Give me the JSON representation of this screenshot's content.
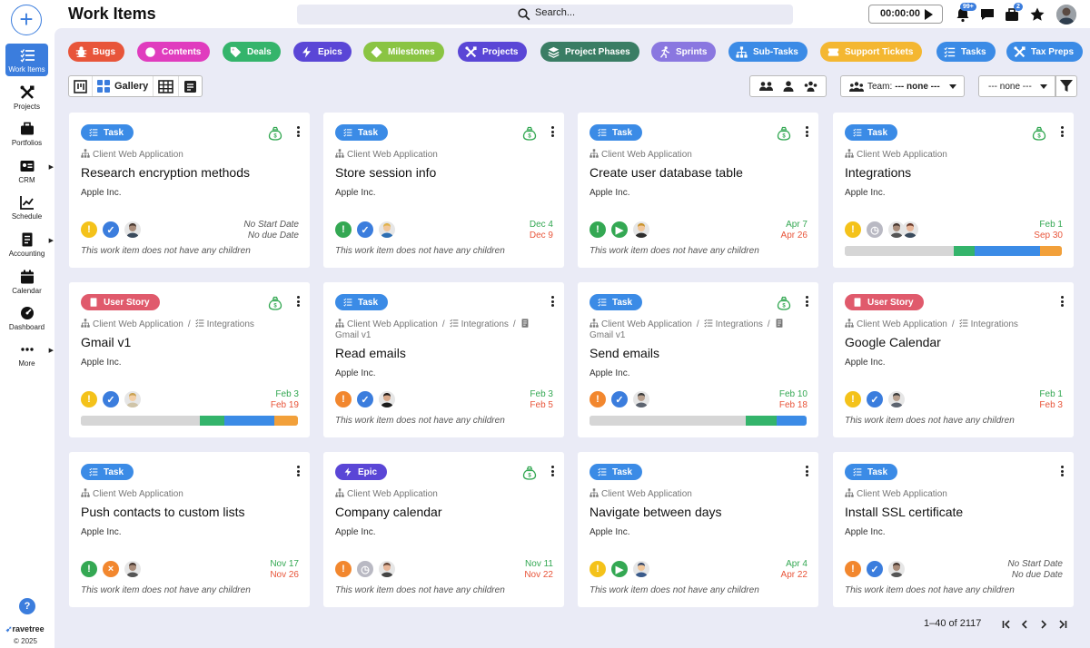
{
  "app": {
    "title": "Work Items"
  },
  "search": {
    "placeholder": "Search..."
  },
  "timer": {
    "value": "00:00:00"
  },
  "notifications": {
    "badge": "99+"
  },
  "cart": {
    "badge": "2"
  },
  "sidebar": {
    "items": [
      {
        "label": "Work Items",
        "icon": "work-items-icon",
        "active": true
      },
      {
        "label": "Projects",
        "icon": "tools-icon"
      },
      {
        "label": "Portfolios",
        "icon": "briefcase-icon"
      },
      {
        "label": "CRM",
        "icon": "contact-card-icon",
        "has_submenu": true
      },
      {
        "label": "Schedule",
        "icon": "chart-icon"
      },
      {
        "label": "Accounting",
        "icon": "ledger-icon",
        "has_submenu": true
      },
      {
        "label": "Calendar",
        "icon": "calendar-icon"
      },
      {
        "label": "Dashboard",
        "icon": "speedometer-icon"
      },
      {
        "label": "More",
        "icon": "ellipsis-icon",
        "has_submenu": true
      }
    ],
    "help_label": "?",
    "brand": "ravetree",
    "copyright": "© 2025"
  },
  "filters": [
    {
      "label": "Bugs",
      "color": "#e8553a",
      "icon": "bug-icon"
    },
    {
      "label": "Contents",
      "color": "#e03cbe",
      "icon": "circle-icon"
    },
    {
      "label": "Deals",
      "color": "#34b46b",
      "icon": "tag-icon"
    },
    {
      "label": "Epics",
      "color": "#5a46d6",
      "icon": "bolt-icon"
    },
    {
      "label": "Milestones",
      "color": "#8ac443",
      "icon": "diamond-icon"
    },
    {
      "label": "Projects",
      "color": "#5a46d6",
      "icon": "tools-icon"
    },
    {
      "label": "Project Phases",
      "color": "#3a7d64",
      "icon": "layers-icon"
    },
    {
      "label": "Sprints",
      "color": "#8a77e0",
      "icon": "runner-icon"
    },
    {
      "label": "Sub-Tasks",
      "color": "#3b8be6",
      "icon": "hierarchy-icon"
    },
    {
      "label": "Support Tickets",
      "color": "#f4b731",
      "icon": "ticket-icon"
    },
    {
      "label": "Tasks",
      "color": "#3b8be6",
      "icon": "checklist-icon"
    },
    {
      "label": "Tax Preps",
      "color": "#3b8be6",
      "icon": "tools-icon"
    }
  ],
  "view": {
    "gallery_label": "Gallery"
  },
  "team_select": {
    "label": "Team:",
    "value": "--- none ---"
  },
  "secondary_select": {
    "value": "--- none ---"
  },
  "cards": [
    {
      "type": "Task",
      "type_color": "#3b8be6",
      "path": [
        "Client Web Application"
      ],
      "title": "Research encryption methods",
      "company": "Apple Inc.",
      "statuses": [
        "yellow-warning",
        "blue-check"
      ],
      "start": "No Start Date",
      "due": "No due Date",
      "dates_none": true,
      "note": "This work item does not have any children",
      "money": true
    },
    {
      "type": "Task",
      "type_color": "#3b8be6",
      "path": [
        "Client Web Application"
      ],
      "title": "Store session info",
      "company": "Apple Inc.",
      "statuses": [
        "green-warning",
        "blue-check"
      ],
      "start": "Dec 4",
      "due": "Dec 9",
      "start_color": "#34a853",
      "due_color": "#e8553a",
      "note": "This work item does not have any children",
      "money": true
    },
    {
      "type": "Task",
      "type_color": "#3b8be6",
      "path": [
        "Client Web Application"
      ],
      "title": "Create user database table",
      "company": "Apple Inc.",
      "statuses": [
        "green-warning",
        "green-play"
      ],
      "start": "Apr 7",
      "due": "Apr 26",
      "start_color": "#34a853",
      "due_color": "#e8553a",
      "note": "This work item does not have any children",
      "money": true
    },
    {
      "type": "Task",
      "type_color": "#3b8be6",
      "path": [
        "Client Web Application"
      ],
      "title": "Integrations",
      "company": "Apple Inc.",
      "statuses": [
        "yellow-warning",
        "gray-clock"
      ],
      "start": "Feb 1",
      "due": "Sep 30",
      "start_color": "#34a853",
      "due_color": "#e8553a",
      "progress": [
        0.5,
        0.1,
        0.3,
        0.1
      ],
      "money": true,
      "two_avatars": true
    },
    {
      "type": "User Story",
      "type_color": "#e05a6c",
      "path": [
        "Client Web Application",
        "Integrations"
      ],
      "title": "Gmail v1",
      "company": "Apple Inc.",
      "statuses": [
        "yellow-warning",
        "blue-check"
      ],
      "start": "Feb 3",
      "due": "Feb 19",
      "start_color": "#34a853",
      "due_color": "#e8553a",
      "progress": [
        0.55,
        0.11,
        0.23,
        0.11
      ],
      "money": true
    },
    {
      "type": "Task",
      "type_color": "#3b8be6",
      "path": [
        "Client Web Application",
        "Integrations",
        "Gmail v1"
      ],
      "title": "Read emails",
      "company": "Apple Inc.",
      "statuses": [
        "orange-warning",
        "blue-check"
      ],
      "start": "Feb 3",
      "due": "Feb 5",
      "start_color": "#34a853",
      "due_color": "#e8553a",
      "note": "This work item does not have any children"
    },
    {
      "type": "Task",
      "type_color": "#3b8be6",
      "path": [
        "Client Web Application",
        "Integrations",
        "Gmail v1"
      ],
      "title": "Send emails",
      "company": "Apple Inc.",
      "statuses": [
        "orange-warning",
        "blue-check"
      ],
      "start": "Feb 10",
      "due": "Feb 18",
      "start_color": "#34a853",
      "due_color": "#e8553a",
      "progress": [
        0.72,
        0.14,
        0.14,
        0
      ],
      "money": true
    },
    {
      "type": "User Story",
      "type_color": "#e05a6c",
      "path": [
        "Client Web Application",
        "Integrations"
      ],
      "title": "Google Calendar",
      "company": "Apple Inc.",
      "statuses": [
        "yellow-warning",
        "blue-check"
      ],
      "start": "Feb 1",
      "due": "Feb 3",
      "start_color": "#34a853",
      "due_color": "#e8553a",
      "note": "This work item does not have any children"
    },
    {
      "type": "Task",
      "type_color": "#3b8be6",
      "path": [
        "Client Web Application"
      ],
      "title": "Push contacts to custom lists",
      "company": "Apple Inc.",
      "statuses": [
        "green-warning",
        "orange-x"
      ],
      "start": "Nov 17",
      "due": "Nov 26",
      "start_color": "#34a853",
      "due_color": "#e8553a",
      "note": "This work item does not have any children"
    },
    {
      "type": "Epic",
      "type_color": "#5a46d6",
      "path": [
        "Client Web Application"
      ],
      "title": "Company calendar",
      "company": "Apple Inc.",
      "statuses": [
        "orange-warning",
        "gray-clock"
      ],
      "start": "Nov 11",
      "due": "Nov 22",
      "start_color": "#34a853",
      "due_color": "#e8553a",
      "note": "This work item does not have any children",
      "money": true
    },
    {
      "type": "Task",
      "type_color": "#3b8be6",
      "path": [
        "Client Web Application"
      ],
      "title": "Navigate between days",
      "company": "Apple Inc.",
      "statuses": [
        "yellow-warning",
        "green-play"
      ],
      "start": "Apr 4",
      "due": "Apr 22",
      "start_color": "#34a853",
      "due_color": "#e8553a",
      "note": "This work item does not have any children"
    },
    {
      "type": "Task",
      "type_color": "#3b8be6",
      "path": [
        "Client Web Application"
      ],
      "title": "Install SSL certificate",
      "company": "Apple Inc.",
      "statuses": [
        "orange-warning",
        "blue-check"
      ],
      "start": "No Start Date",
      "due": "No due Date",
      "dates_none": true,
      "note": "This work item does not have any children"
    }
  ],
  "pagination": {
    "info": "1–40 of 2117"
  }
}
